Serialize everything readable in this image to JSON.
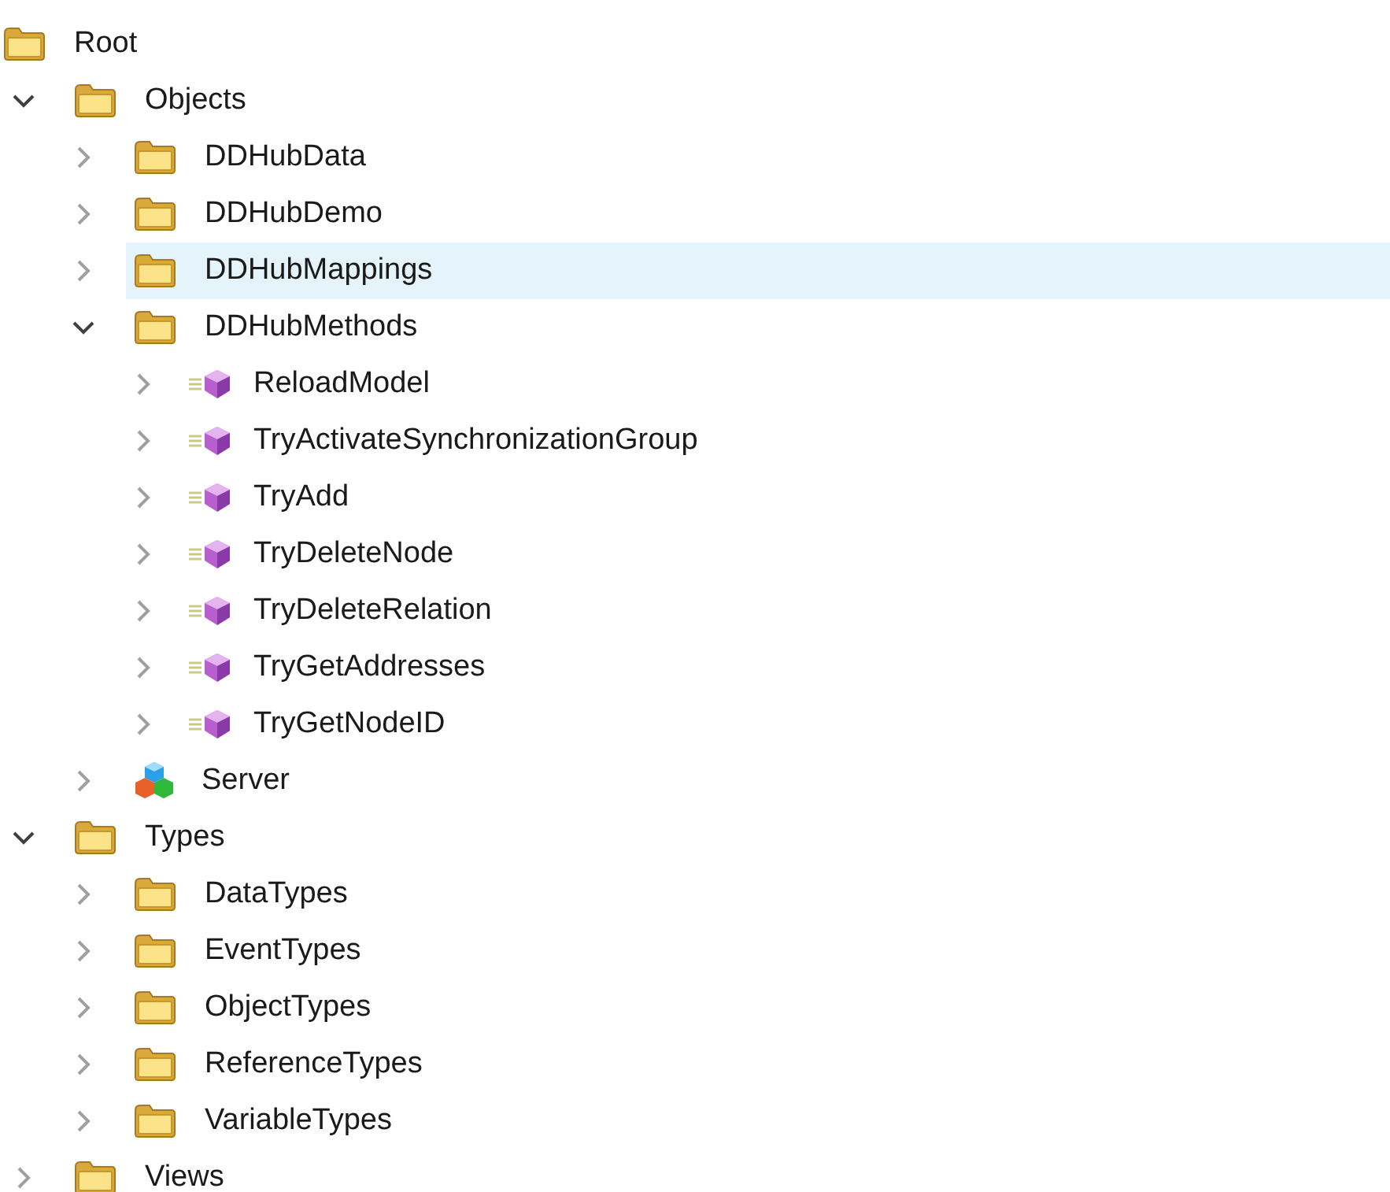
{
  "tree": [
    {
      "label": "Root",
      "kind": "folder",
      "selected": false,
      "children": [
        {
          "label": "Objects",
          "kind": "folder",
          "expanded": true,
          "selected": false,
          "children": [
            {
              "label": "DDHubData",
              "kind": "folder",
              "expanded": false,
              "selected": false
            },
            {
              "label": "DDHubDemo",
              "kind": "folder",
              "expanded": false,
              "selected": false
            },
            {
              "label": "DDHubMappings",
              "kind": "folder",
              "expanded": false,
              "selected": true
            },
            {
              "label": "DDHubMethods",
              "kind": "folder",
              "expanded": true,
              "selected": false,
              "children": [
                {
                  "label": "ReloadModel",
                  "kind": "method",
                  "expanded": false,
                  "selected": false
                },
                {
                  "label": "TryActivateSynchronizationGroup",
                  "kind": "method",
                  "expanded": false,
                  "selected": false
                },
                {
                  "label": "TryAdd",
                  "kind": "method",
                  "expanded": false,
                  "selected": false
                },
                {
                  "label": "TryDeleteNode",
                  "kind": "method",
                  "expanded": false,
                  "selected": false
                },
                {
                  "label": "TryDeleteRelation",
                  "kind": "method",
                  "expanded": false,
                  "selected": false
                },
                {
                  "label": "TryGetAddresses",
                  "kind": "method",
                  "expanded": false,
                  "selected": false
                },
                {
                  "label": "TryGetNodeID",
                  "kind": "method",
                  "expanded": false,
                  "selected": false
                }
              ]
            },
            {
              "label": "Server",
              "kind": "server",
              "expanded": false,
              "selected": false
            }
          ]
        },
        {
          "label": "Types",
          "kind": "folder",
          "expanded": true,
          "selected": false,
          "children": [
            {
              "label": "DataTypes",
              "kind": "folder",
              "expanded": false,
              "selected": false
            },
            {
              "label": "EventTypes",
              "kind": "folder",
              "expanded": false,
              "selected": false
            },
            {
              "label": "ObjectTypes",
              "kind": "folder",
              "expanded": false,
              "selected": false
            },
            {
              "label": "ReferenceTypes",
              "kind": "folder",
              "expanded": false,
              "selected": false
            },
            {
              "label": "VariableTypes",
              "kind": "folder",
              "expanded": false,
              "selected": false
            }
          ]
        },
        {
          "label": "Views",
          "kind": "folder",
          "expanded": false,
          "selected": false
        }
      ]
    }
  ]
}
